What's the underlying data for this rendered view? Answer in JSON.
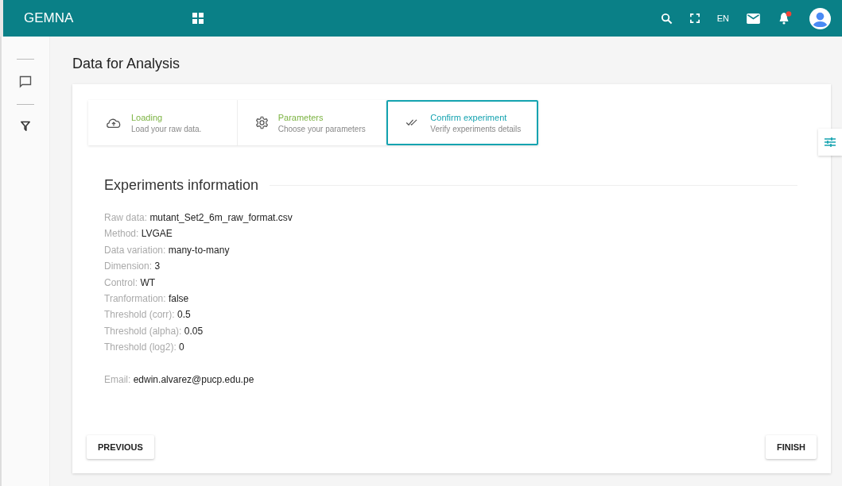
{
  "app": {
    "title": "GEMNA",
    "language": "EN",
    "notifications_unread": true
  },
  "page": {
    "title": "Data for Analysis"
  },
  "steps": [
    {
      "kind": "upload",
      "title": "Loading",
      "subtitle": "Load your raw data.",
      "completed": true,
      "selected": false
    },
    {
      "kind": "settings",
      "title": "Parameters",
      "subtitle": "Choose your parameters",
      "completed": true,
      "selected": false
    },
    {
      "kind": "confirm",
      "title": "Confirm experiment",
      "subtitle": "Verify experiments details",
      "completed": false,
      "selected": true
    }
  ],
  "section": {
    "title": "Experiments information"
  },
  "fields": [
    {
      "label": "Raw data:",
      "value": "mutant_Set2_6m_raw_format.csv"
    },
    {
      "label": "Method:",
      "value": "LVGAE"
    },
    {
      "label": "Data variation:",
      "value": "many-to-many"
    },
    {
      "label": "Dimension:",
      "value": "3"
    },
    {
      "label": "Control:",
      "value": "WT"
    },
    {
      "label": "Tranformation:",
      "value": "false"
    },
    {
      "label": "Threshold (corr):",
      "value": "0.5"
    },
    {
      "label": "Threshold (alpha):",
      "value": "0.05"
    },
    {
      "label": "Threshold (log2):",
      "value": "0"
    }
  ],
  "email": {
    "label": "Email:",
    "value": "edwin.alvarez@pucp.edu.pe"
  },
  "buttons": {
    "previous": "PREVIOUS",
    "finish": "FINISH"
  }
}
